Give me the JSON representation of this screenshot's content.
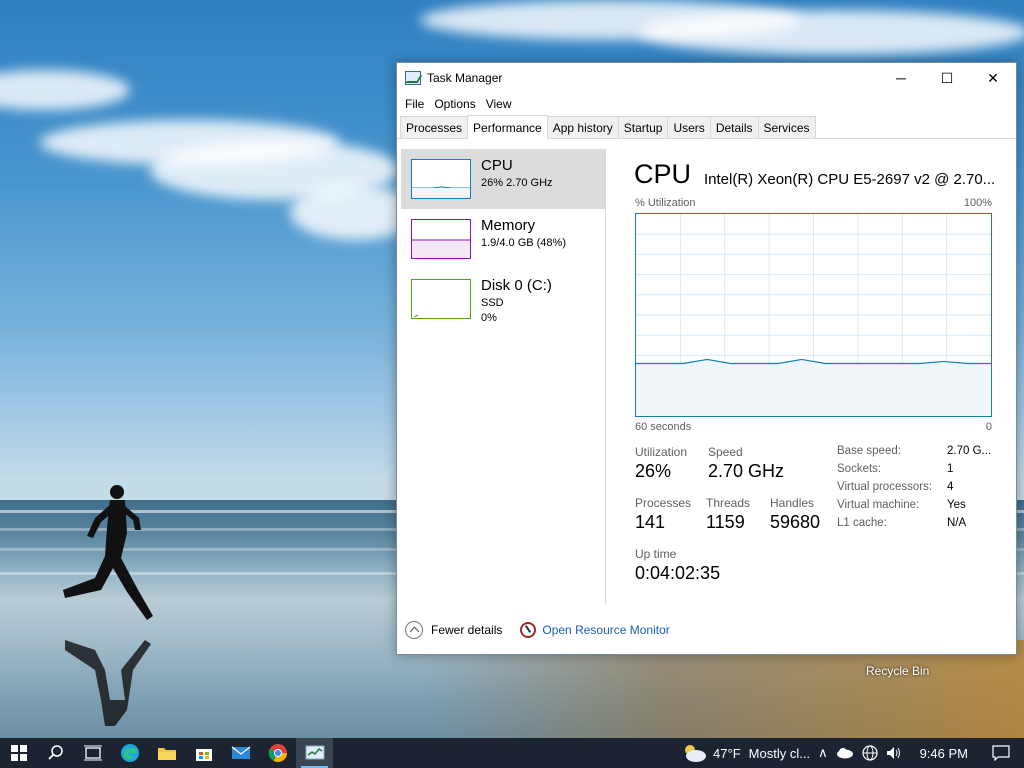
{
  "desktop": {
    "recycle_bin_label": "Recycle Bin"
  },
  "window": {
    "title": "Task Manager",
    "controls": {
      "minimize": "─",
      "maximize": "☐",
      "close": "✕"
    }
  },
  "menu": [
    "File",
    "Options",
    "View"
  ],
  "tabs": [
    "Processes",
    "Performance",
    "App history",
    "Startup",
    "Users",
    "Details",
    "Services"
  ],
  "active_tab": "Performance",
  "sidebar": {
    "items": [
      {
        "name": "CPU",
        "line1": "26%  2.70 GHz",
        "line2": "",
        "color": "#117dbb"
      },
      {
        "name": "Memory",
        "line1": "1.9/4.0 GB (48%)",
        "line2": "",
        "color": "#8b12ae"
      },
      {
        "name": "Disk 0 (C:)",
        "line1": "SSD",
        "line2": "0%",
        "color": "#4da60c"
      }
    ]
  },
  "cpu": {
    "title": "CPU",
    "model": "Intel(R) Xeon(R) CPU E5-2697 v2 @ 2.70...",
    "graph_label_left": "% Utilization",
    "graph_label_right": "100%",
    "time_left": "60 seconds",
    "time_right": "0",
    "stats": {
      "utilization_label": "Utilization",
      "utilization": "26%",
      "speed_label": "Speed",
      "speed": "2.70 GHz",
      "processes_label": "Processes",
      "processes": "141",
      "threads_label": "Threads",
      "threads": "1159",
      "handles_label": "Handles",
      "handles": "59680",
      "uptime_label": "Up time",
      "uptime": "0:04:02:35"
    },
    "details": [
      {
        "label": "Base speed:",
        "value": "2.70 G..."
      },
      {
        "label": "Sockets:",
        "value": "1"
      },
      {
        "label": "Virtual processors:",
        "value": "4"
      },
      {
        "label": "Virtual machine:",
        "value": "Yes"
      },
      {
        "label": "L1 cache:",
        "value": "N/A"
      }
    ]
  },
  "chart_data": {
    "type": "area",
    "title": "% Utilization",
    "ylim": [
      0,
      100
    ],
    "x": [
      60,
      56,
      52,
      48,
      44,
      40,
      36,
      32,
      28,
      24,
      20,
      16,
      12,
      8,
      4,
      0
    ],
    "values": [
      26,
      26,
      26,
      28,
      26,
      26,
      26,
      28,
      26,
      26,
      26,
      26,
      26,
      27,
      26,
      26
    ],
    "grid": true
  },
  "footer": {
    "fewer_details": "Fewer details",
    "open_resource_monitor": "Open Resource Monitor"
  },
  "taskbar": {
    "weather_temp": "47°F",
    "weather_text": "Mostly cl...",
    "time": "9:46 PM"
  }
}
